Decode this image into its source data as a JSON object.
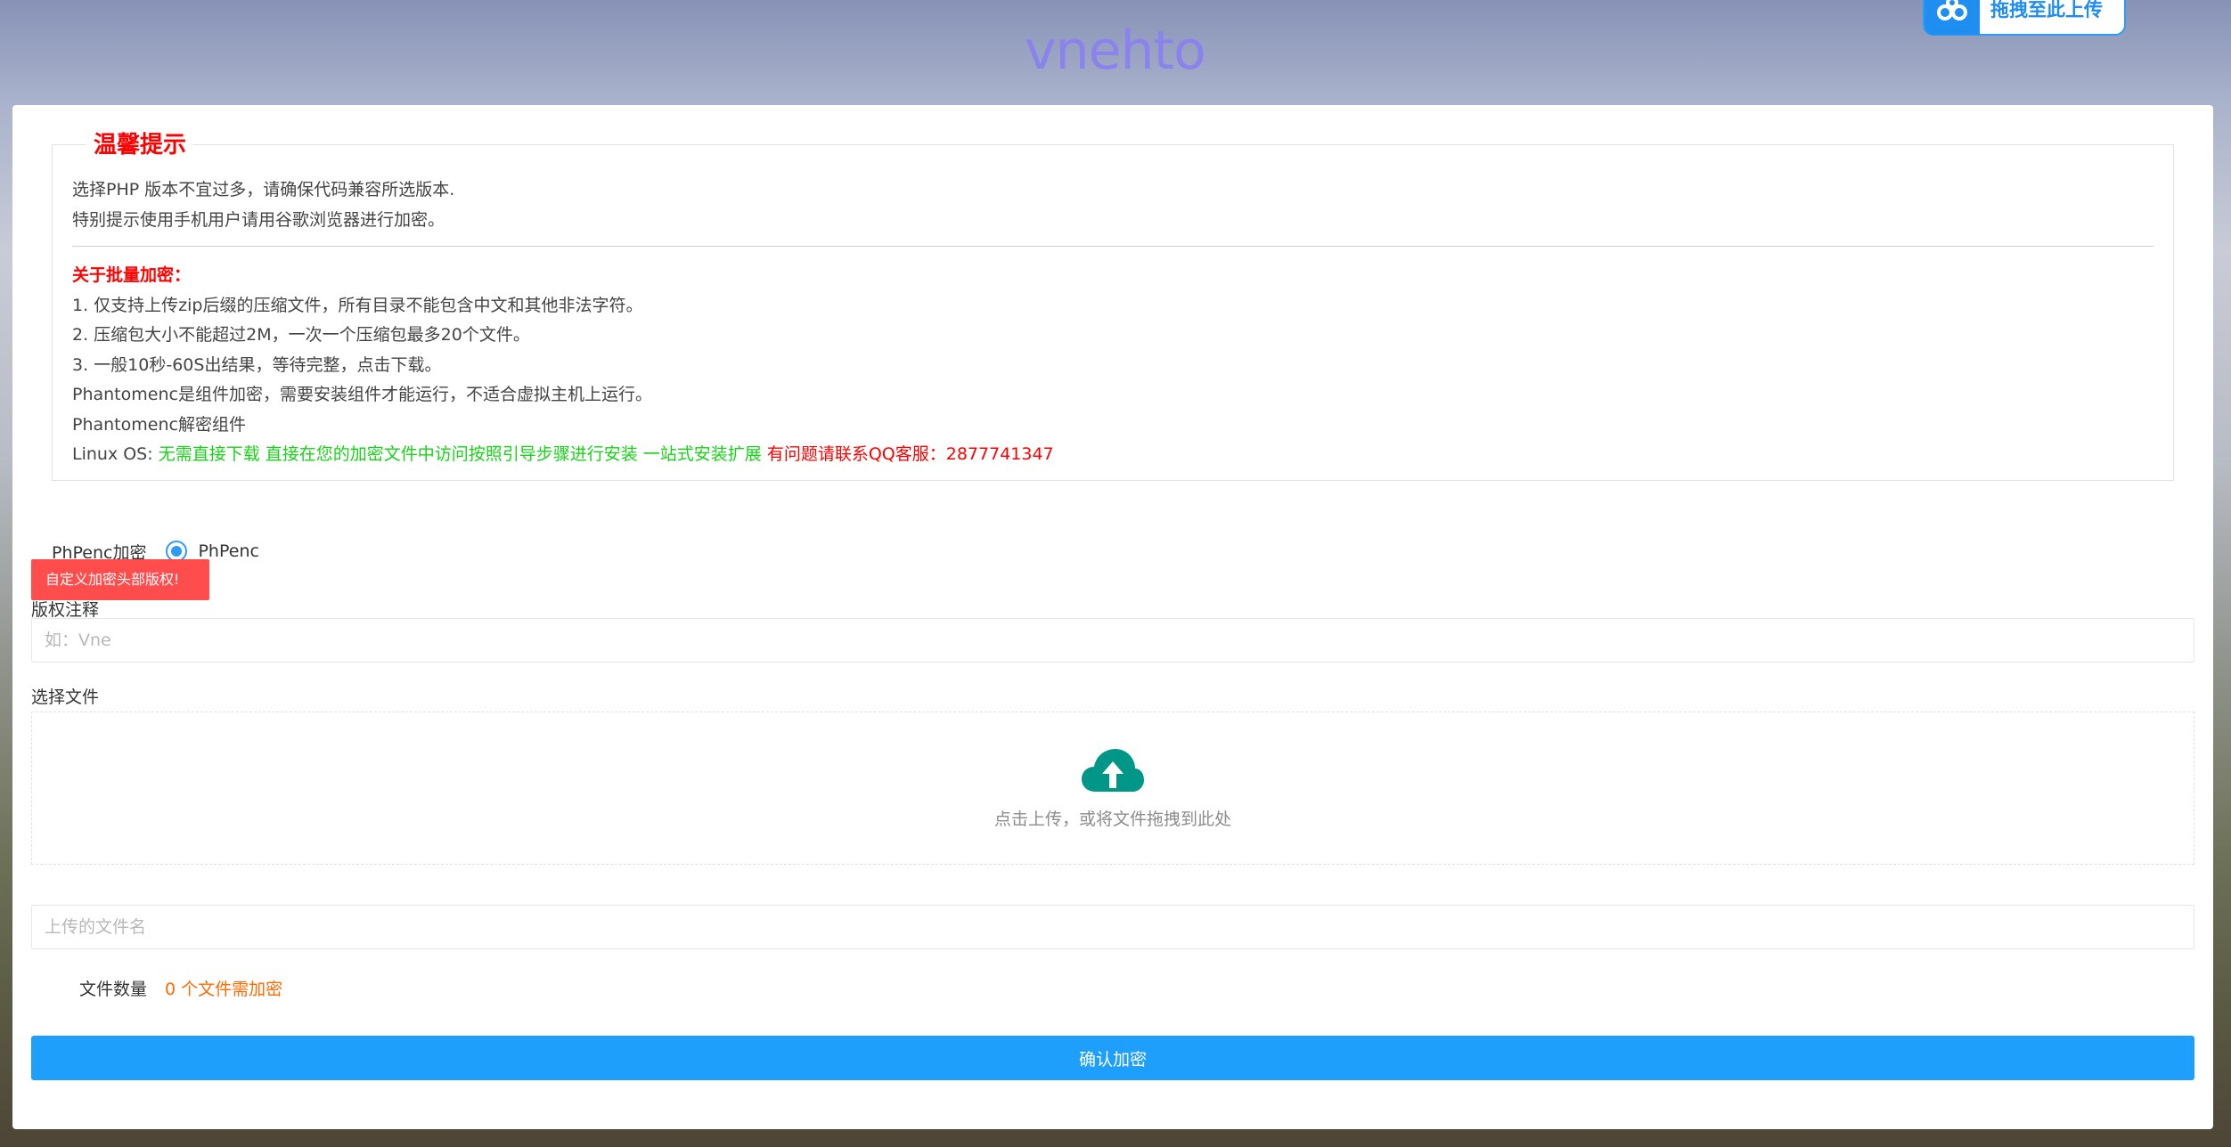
{
  "header": {
    "logo": "vnehto",
    "drag_upload_label": "拖拽至此上传"
  },
  "tips": {
    "title": "温馨提示",
    "line1": "选择PHP 版本不宜过多，请确保代码兼容所选版本.",
    "line2": "特别提示使用手机用户请用谷歌浏览器进行加密。",
    "batch_title": "关于批量加密：",
    "batch_1": "1. 仅支持上传zip后缀的压缩文件，所有目录不能包含中文和其他非法字符。",
    "batch_2": "2. 压缩包大小不能超过2M，一次一个压缩包最多20个文件。",
    "batch_3": "3. 一般10秒-60S出结果，等待完整，点击下载。",
    "phantom_note": "Phantomenc是组件加密，需要安装组件才能运行，不适合虚拟主机上运行。",
    "phantom_decrypt": "Phantomenc解密组件",
    "linux_label": "Linux OS: ",
    "linux_green": "无需直接下载 直接在您的加密文件中访问按照引导步骤进行安装 一站式安装扩展",
    "linux_red": " 有问题请联系QQ客服：2877741347"
  },
  "form": {
    "encrypt_label": "PhPenc加密",
    "radio_option": "PhPenc",
    "tooltip": "自定义加密头部版权!",
    "copyright_label": "版权注释",
    "copyright_placeholder": "如：Vne",
    "file_label": "选择文件",
    "dropzone_text": "点击上传，或将文件拖拽到此处",
    "filename_placeholder": "上传的文件名",
    "count_label": "文件数量",
    "count_value": "0 个文件需加密",
    "submit_label": "确认加密"
  },
  "colors": {
    "accent": "#1e9ffc",
    "warning_red": "#ff0000",
    "green_text": "#19d219",
    "orange_text": "#ff6a00",
    "cloud_icon": "#009688"
  }
}
